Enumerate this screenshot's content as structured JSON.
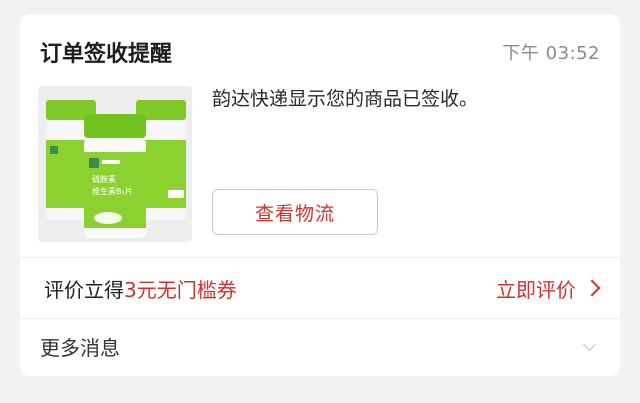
{
  "notification": {
    "title": "订单签收提醒",
    "time": "下午 03:52",
    "message": "韵达快递显示您的商品已签收。",
    "view_logistics_label": "查看物流",
    "product_image_icon": "vitamin-bottles-image",
    "product_label_line1": "硫胺素",
    "product_label_line2": "维生素B₁片"
  },
  "review": {
    "prefix": "评价立得",
    "highlight": "3元无门槛券",
    "action_label": "立即评价",
    "action_icon": "chevron-right-icon"
  },
  "more": {
    "label": "更多消息",
    "icon": "chevron-down-icon"
  },
  "colors": {
    "accent_red": "#d6312a",
    "bottle_green": "#8bd12f",
    "background": "#f2f2f2"
  }
}
